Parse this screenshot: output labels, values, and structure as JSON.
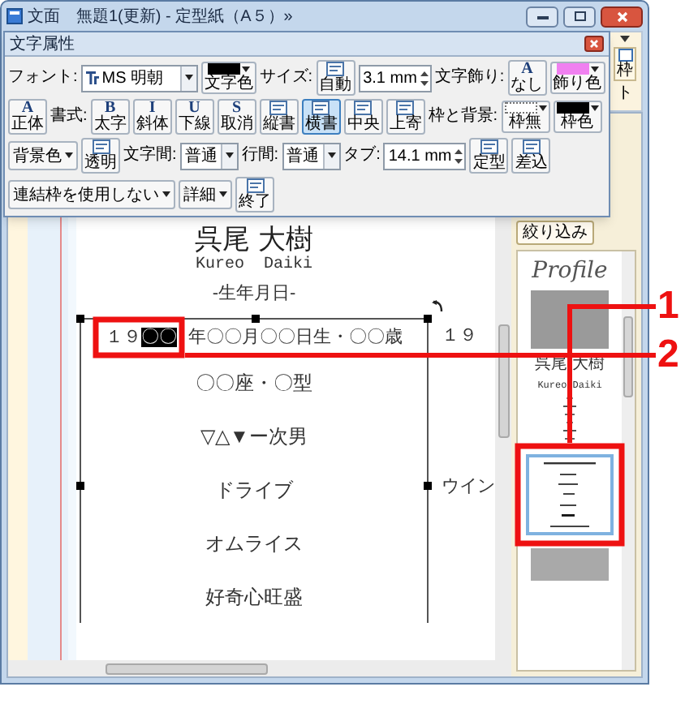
{
  "window": {
    "title": "文面　無題1(更新) - 定型紙（A５）»"
  },
  "toolbar": {
    "frame_button": "枠",
    "cut_label": "ト",
    "filter_button": "絞り込み"
  },
  "dialog": {
    "title": "文字属性",
    "controls": [
      {
        "kind": "label",
        "text": "フォント:"
      },
      {
        "kind": "select",
        "value": "MS 明朝",
        "font_icon": true
      },
      {
        "kind": "swatch",
        "label": "文字色",
        "color": "#000000"
      },
      {
        "kind": "label",
        "text": "サイズ:"
      },
      {
        "kind": "icon_button",
        "label": "自動",
        "selected": false
      },
      {
        "kind": "spin",
        "value": "3.1 mm"
      },
      {
        "kind": "label",
        "text": "文字飾り:"
      },
      {
        "kind": "icon_button",
        "glyph": "A",
        "label": "なし",
        "selected": false
      },
      {
        "kind": "swatch",
        "label": "飾り色",
        "color": "#f080f0"
      },
      {
        "kind": "icon_button",
        "glyph": "A",
        "label": "正体",
        "selected": false
      },
      {
        "kind": "label",
        "text": "書式:"
      },
      {
        "kind": "icon_button",
        "glyph": "B",
        "label": "太字",
        "selected": false
      },
      {
        "kind": "icon_button",
        "glyph": "I",
        "label": "斜体",
        "selected": false
      },
      {
        "kind": "icon_button",
        "glyph": "U",
        "label": "下線",
        "selected": false
      },
      {
        "kind": "icon_button",
        "glyph": "S",
        "label": "取消",
        "selected": false
      },
      {
        "kind": "icon_button",
        "label": "縦書",
        "selected": false
      },
      {
        "kind": "icon_button",
        "label": "横書",
        "selected": true
      },
      {
        "kind": "icon_button",
        "label": "中央",
        "selected": false
      },
      {
        "kind": "icon_button",
        "label": "上寄",
        "selected": false
      },
      {
        "kind": "label",
        "text": "枠と背景:"
      },
      {
        "kind": "swatch",
        "label": "枠無"
      },
      {
        "kind": "swatch",
        "label": "枠色",
        "color": "#000000"
      },
      {
        "kind": "dropdown",
        "label": "背景色"
      },
      {
        "kind": "icon_button",
        "label": "透明",
        "selected": false
      },
      {
        "kind": "label",
        "text": "文字間:"
      },
      {
        "kind": "select",
        "value": "普通"
      },
      {
        "kind": "label",
        "text": "行間:"
      },
      {
        "kind": "select",
        "value": "普通"
      },
      {
        "kind": "label",
        "text": "タブ:"
      },
      {
        "kind": "spin",
        "value": "14.1 mm"
      },
      {
        "kind": "icon_button",
        "label": "定型",
        "selected": false
      },
      {
        "kind": "icon_button",
        "label": "差込",
        "selected": false
      },
      {
        "kind": "dropdown",
        "label": "連結枠を使用しない"
      },
      {
        "kind": "dropdown",
        "label": "詳細"
      },
      {
        "kind": "icon_button",
        "label": "終了",
        "selected": false
      }
    ]
  },
  "document": {
    "name": "呉尾 大樹",
    "romaji": "Kureo  Daiki",
    "heading": "-生年月日-",
    "lines": [
      {
        "kind": "birth",
        "before": "１９",
        "selected_text": "〇〇",
        "after": "年〇〇月〇〇日生・〇〇歳",
        "overflow": "１９"
      },
      {
        "kind": "plain",
        "text": "〇〇座・〇型"
      },
      {
        "kind": "plain",
        "text": "▽△▼ー次男"
      },
      {
        "kind": "plain",
        "text": "ドライブ",
        "overflow": "ウイン"
      },
      {
        "kind": "plain",
        "text": "オムライス"
      },
      {
        "kind": "plain",
        "text": "好奇心旺盛"
      }
    ]
  },
  "preview": {
    "pages": [
      {
        "kind": "profile",
        "selected": false,
        "heading": "Profile",
        "name": "呉尾 大樹",
        "romaji": "Kureo Daiki"
      },
      {
        "kind": "lines",
        "selected": true
      },
      {
        "kind": "blank",
        "selected": false
      }
    ]
  },
  "annotations": [
    {
      "label": "1",
      "kind": "thumbnail"
    },
    {
      "label": "2",
      "kind": "selection"
    }
  ]
}
